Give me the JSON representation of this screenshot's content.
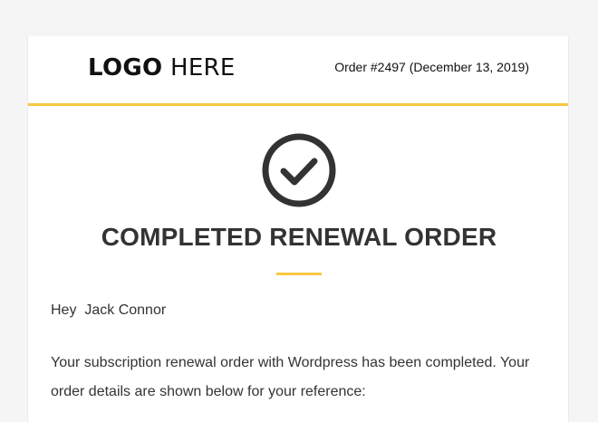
{
  "header": {
    "logo_bold": "LOGO",
    "logo_light": "HERE",
    "order_info": "Order #2497 (December 13, 2019)"
  },
  "hero": {
    "icon": "check-circle-icon",
    "title": "COMPLETED RENEWAL ORDER"
  },
  "body": {
    "greeting": "Hey  Jack Connor",
    "message": "Your subscription renewal order with Wordpress has been completed. Your order details are shown below for your reference:"
  },
  "colors": {
    "accent": "#f5c842",
    "text": "#333333",
    "background": "#f5f5f5",
    "card": "#ffffff"
  }
}
